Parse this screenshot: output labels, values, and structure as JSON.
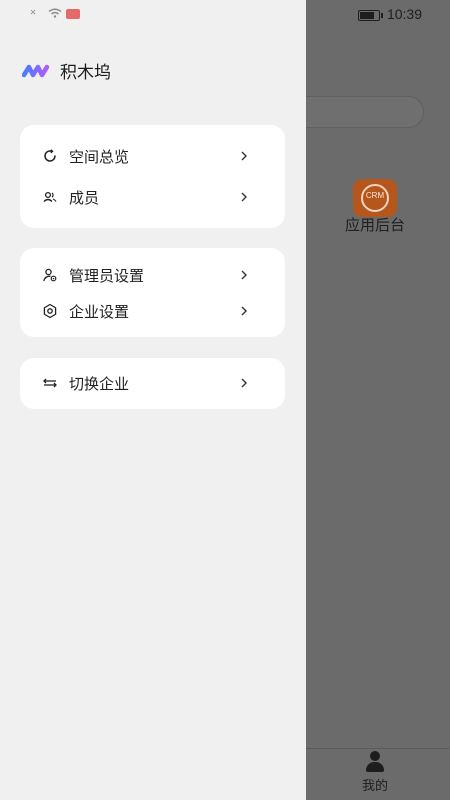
{
  "status_bar": {
    "signal_text": "✕",
    "time": "10:39"
  },
  "background_app": {
    "app_label": "应用后台",
    "app_icon_text": "CRM",
    "tab_me_label": "我的"
  },
  "drawer": {
    "brand_name": "积木坞",
    "cards": [
      {
        "items": [
          {
            "label": "空间总览",
            "icon": "refresh-circle-icon"
          },
          {
            "label": "成员",
            "icon": "members-icon"
          }
        ]
      },
      {
        "items": [
          {
            "label": "管理员设置",
            "icon": "admin-user-gear-icon"
          },
          {
            "label": "企业设置",
            "icon": "hexagon-settings-icon"
          }
        ]
      },
      {
        "items": [
          {
            "label": "切换企业",
            "icon": "switch-arrows-icon"
          }
        ]
      }
    ]
  },
  "colors": {
    "drawer_bg": "#f0f0f0",
    "card_bg": "#ffffff",
    "overlay": "#6b6b6b",
    "app_icon_orange": "#b5561d",
    "text_primary": "#222222"
  }
}
